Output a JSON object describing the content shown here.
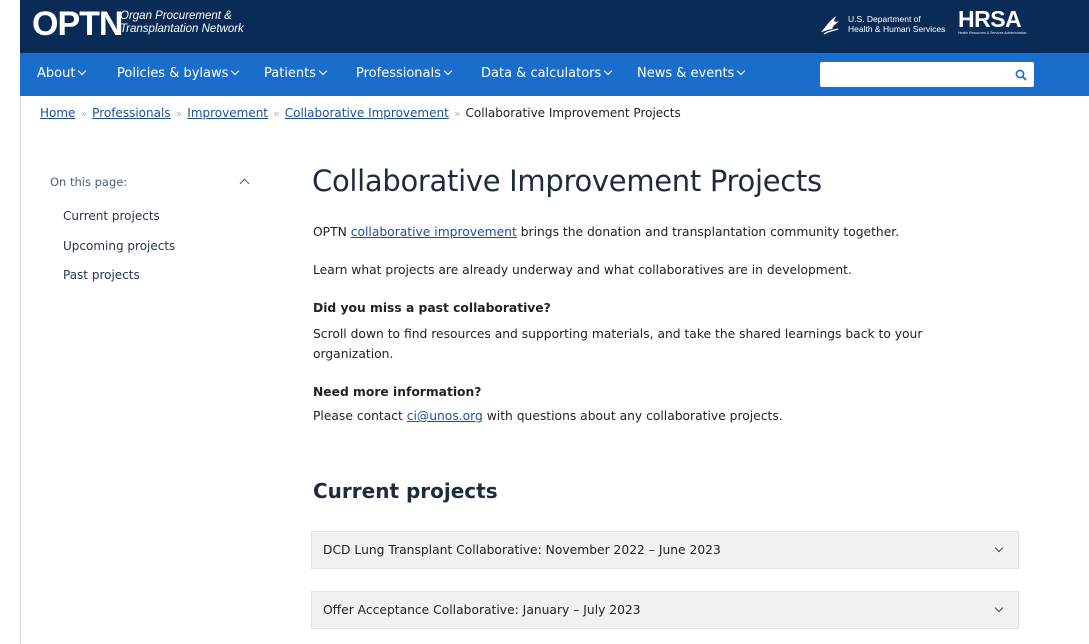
{
  "header": {
    "logo_main": "OPTN",
    "logo_sub_line1": "Organ Procurement &",
    "logo_sub_line2": "Transplantation Network",
    "hhs_line1": "U.S. Department of",
    "hhs_line2": "Health & Human Services",
    "hrsa_word": "HRSA",
    "hrsa_tag": "Health Resources & Services Administration",
    "bg_color": "#0b2b57"
  },
  "nav": {
    "bg_color": "#1a6ecb",
    "items": [
      {
        "label": "About"
      },
      {
        "label": "Policies & bylaws"
      },
      {
        "label": "Patients"
      },
      {
        "label": "Professionals"
      },
      {
        "label": "Data & calculators"
      },
      {
        "label": "News & events"
      }
    ],
    "search": {
      "value": "",
      "placeholder": "",
      "icon": "search-icon"
    }
  },
  "breadcrumb": {
    "items": [
      "Home",
      "Professionals",
      "Improvement",
      "Collaborative Improvement"
    ],
    "current": "Collaborative Improvement Projects",
    "separator": "»"
  },
  "sidebar": {
    "heading": "On this page:",
    "items": [
      "Current projects",
      "Upcoming projects",
      "Past projects"
    ]
  },
  "main": {
    "title": "Collaborative Improvement Projects",
    "intro_prefix": "OPTN ",
    "intro_link": "collaborative improvement",
    "intro_suffix": " brings the donation and transplantation community together.",
    "learn": "Learn what projects are already underway and what collaboratives are in development.",
    "missed_heading": "Did you miss a past collaborative?",
    "missed_line1": "Scroll down to find resources and supporting materials, and take the shared learnings back to your",
    "missed_line2": "organization.",
    "info_heading": "Need more information?",
    "info_prefix": "Please contact ",
    "info_link": "ci@unos.org",
    "info_suffix": " with questions about any collaborative projects.",
    "current_heading": "Current projects",
    "accordions": [
      "DCD Lung Transplant Collaborative: November 2022 – June 2023",
      "Offer Acceptance Collaborative: January – July 2023"
    ]
  }
}
